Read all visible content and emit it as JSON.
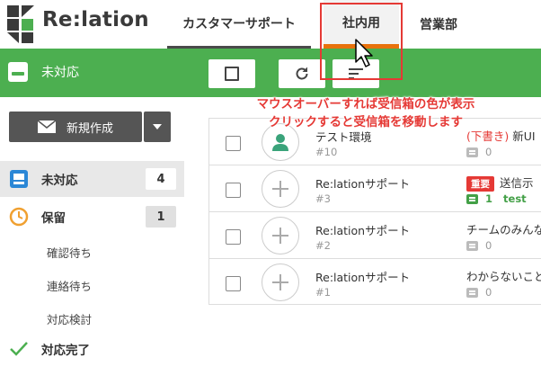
{
  "app": {
    "logo_text": "Re:lation"
  },
  "header": {
    "tabs": [
      {
        "label": "カスタマーサポート"
      },
      {
        "label": "社内用"
      },
      {
        "label": "営業部"
      }
    ]
  },
  "toolbar": {
    "title": "未対応"
  },
  "annotation": {
    "line1": "マウスオーバーすれば受信箱の色が表示",
    "line2": "クリックすると受信箱を移動します",
    "color": "#e53935"
  },
  "sidebar": {
    "new_button_label": "新規作成",
    "unread": {
      "label": "未対応",
      "count": "4"
    },
    "hold": {
      "label": "保留",
      "count": "1"
    },
    "sub_items": [
      "確認待ち",
      "連絡待ち",
      "対応検討"
    ],
    "done": {
      "label": "対応完了"
    }
  },
  "list": {
    "rows": [
      {
        "name": "テスト環境",
        "id": "#10",
        "right_prefix": "(下書き)",
        "right_text": " 新UI",
        "comment_count": "0"
      },
      {
        "name": "Re:lationサポート",
        "id": "#3",
        "badge": "重要",
        "right_text": "送信示",
        "comment_count": "1",
        "comment_text": "test"
      },
      {
        "name": "Re:lationサポート",
        "id": "#2",
        "right_text": "チームのみんな",
        "comment_count": "0"
      },
      {
        "name": "Re:lationサポート",
        "id": "#1",
        "right_text": "わからないこと",
        "comment_count": "0"
      }
    ]
  },
  "colors": {
    "brand_green": "#4caf50",
    "accent_orange": "#e8720c"
  }
}
